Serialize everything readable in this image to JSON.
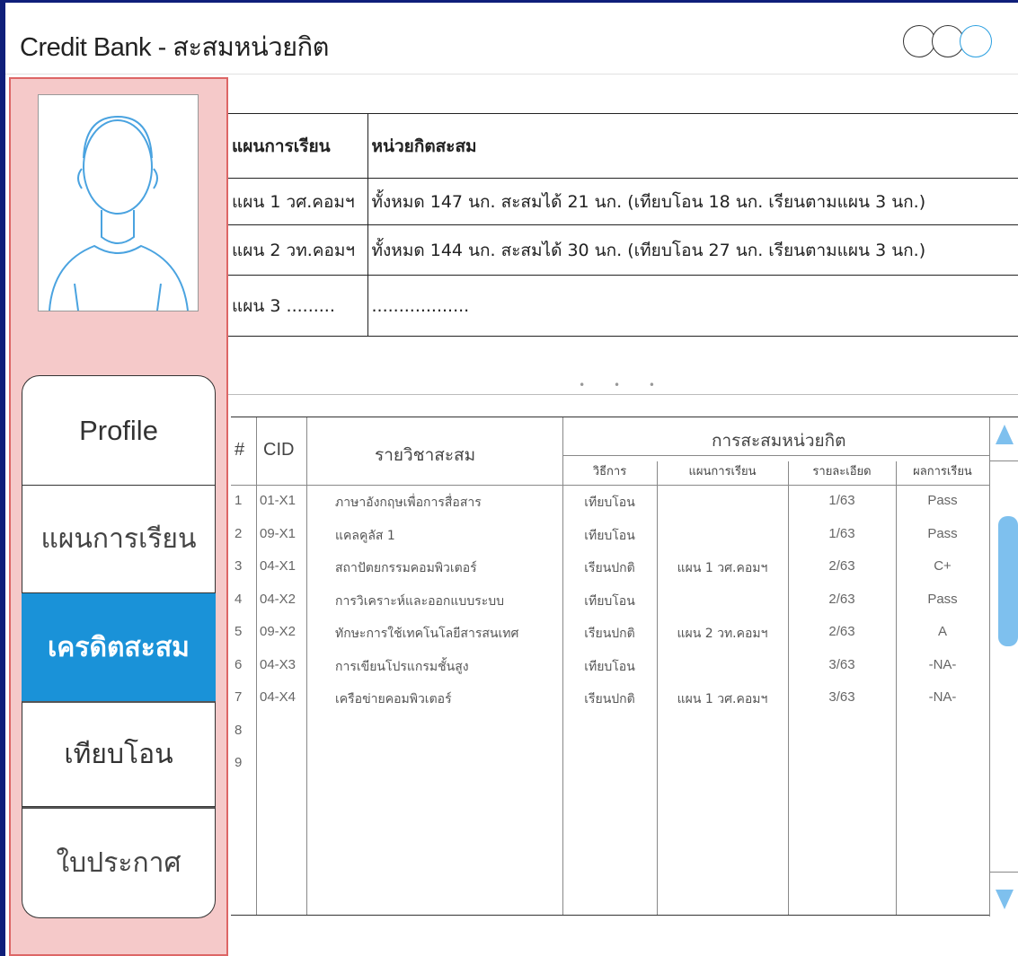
{
  "app": {
    "title": "Credit Bank - สะสมหน่วยกิต"
  },
  "sidebar": {
    "avatar_icon": "user-avatar-icon",
    "nav": [
      {
        "label": "Profile"
      },
      {
        "label": "แผนการเรียน"
      },
      {
        "label": "เครดิตสะสม",
        "active": true
      },
      {
        "label": "เทียบโอน"
      },
      {
        "label": "ใบประกาศ"
      }
    ],
    "active_color": "#1a92d8",
    "background": "#f5c9c9"
  },
  "plan_table": {
    "headers": [
      "แผนการเรียน",
      "หน่วยกิตสะสม"
    ],
    "rows": [
      [
        "แผน 1 วศ.คอมฯ",
        "ทั้งหมด 147 นก. สะสมได้ 21 นก. (เทียบโอน 18 นก. เรียนตามแผน 3 นก.)"
      ],
      [
        "แผน 2 วท.คอมฯ",
        "ทั้งหมด 144 นก. สะสมได้ 30 นก. (เทียบโอน 27 นก. เรียนตามแผน 3 นก.)"
      ],
      [
        "แผน 3 .........",
        ".................."
      ]
    ]
  },
  "credit_table": {
    "headers": {
      "num": "#",
      "cid": "CID",
      "subject": "รายวิชาสะสม",
      "group": "การสะสมหน่วยกิต",
      "method": "วิธีการ",
      "plan": "แผนการเรียน",
      "detail": "รายละเอียด",
      "result": "ผลการเรียน"
    },
    "rows": [
      {
        "n": "1",
        "cid": "01-X1",
        "subject": "ภาษาอังกฤษเพื่อการสื่อสาร",
        "method": "เทียบโอน",
        "plan": "",
        "detail": "1/63",
        "result": "Pass"
      },
      {
        "n": "2",
        "cid": "09-X1",
        "subject": "แคลคูลัส 1",
        "method": "เทียบโอน",
        "plan": "",
        "detail": "1/63",
        "result": "Pass"
      },
      {
        "n": "3",
        "cid": "04-X1",
        "subject": "สถาปัตยกรรมคอมพิวเตอร์",
        "method": "เรียนปกติ",
        "plan": "แผน 1 วศ.คอมฯ",
        "detail": "2/63",
        "result": "C+"
      },
      {
        "n": "4",
        "cid": "04-X2",
        "subject": "การวิเคราะห์และออกแบบระบบ",
        "method": "เทียบโอน",
        "plan": "",
        "detail": "2/63",
        "result": "Pass"
      },
      {
        "n": "5",
        "cid": "09-X2",
        "subject": "ทักษะการใช้เทคโนโลยีสารสนเทศ",
        "method": "เรียนปกติ",
        "plan": "แผน 2 วท.คอมฯ",
        "detail": "2/63",
        "result": "A"
      },
      {
        "n": "6",
        "cid": "04-X3",
        "subject": "การเขียนโปรแกรมชั้นสูง",
        "method": "เทียบโอน",
        "plan": "",
        "detail": "3/63",
        "result": "-NA-"
      },
      {
        "n": "7",
        "cid": "04-X4",
        "subject": "เครือข่ายคอมพิวเตอร์",
        "method": "เรียนปกติ",
        "plan": "แผน 1 วศ.คอมฯ",
        "detail": "3/63",
        "result": "-NA-"
      },
      {
        "n": "8",
        "cid": "",
        "subject": "",
        "method": "",
        "plan": "",
        "detail": "",
        "result": ""
      },
      {
        "n": "9",
        "cid": "",
        "subject": "",
        "method": "",
        "plan": "",
        "detail": "",
        "result": ""
      }
    ]
  },
  "splitter_glyph": "• • •",
  "accent_color": "#7ec0ee"
}
